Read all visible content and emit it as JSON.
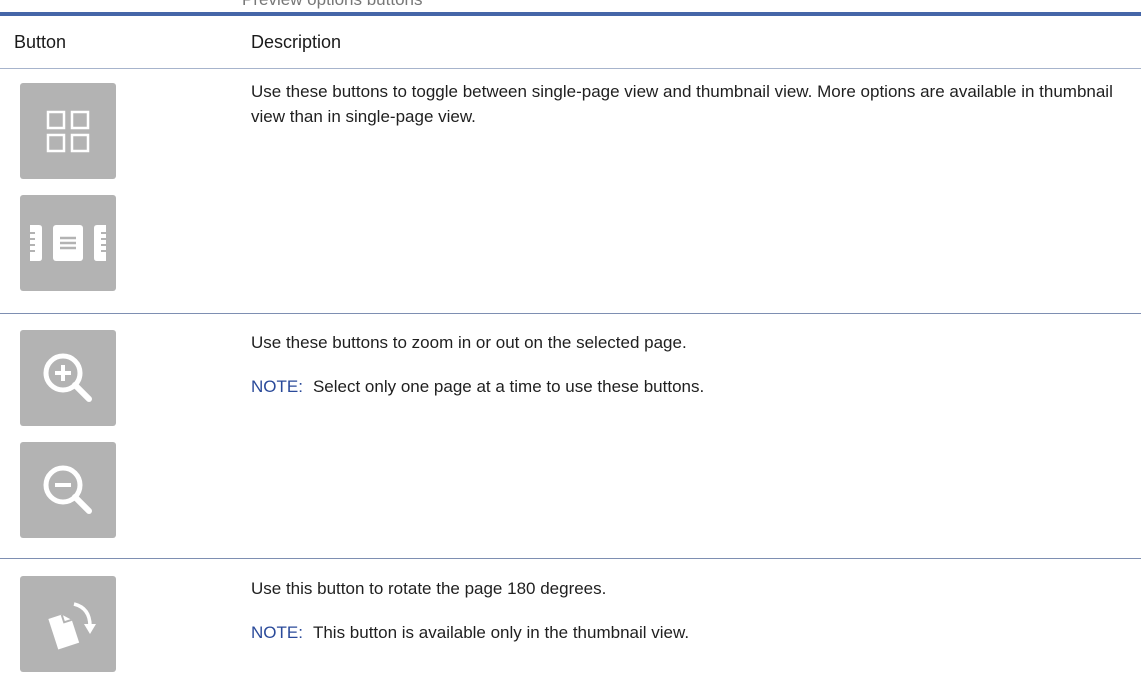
{
  "cut_caption": "Preview options buttons",
  "table": {
    "headers": {
      "button": "Button",
      "description": "Description"
    },
    "rows": [
      {
        "buttons": [
          "thumbnail-view-icon",
          "single-page-view-icon"
        ],
        "description": "Use these buttons to toggle between single-page view and thumbnail view. More options are available in thumbnail view than in single-page view."
      },
      {
        "buttons": [
          "zoom-in-icon",
          "zoom-out-icon"
        ],
        "description": "Use these buttons to zoom in or out on the selected page.",
        "note_label": "NOTE:",
        "note_text": "Select only one page at a time to use these buttons."
      },
      {
        "buttons": [
          "rotate-page-icon"
        ],
        "description": "Use this button to rotate the page 180 degrees.",
        "note_label": "NOTE:",
        "note_text": "This button is available only in the thumbnail view."
      }
    ]
  },
  "colors": {
    "rule": "#4566a8",
    "tile": "#b3b3b3",
    "note_label": "#2a4a9a"
  }
}
